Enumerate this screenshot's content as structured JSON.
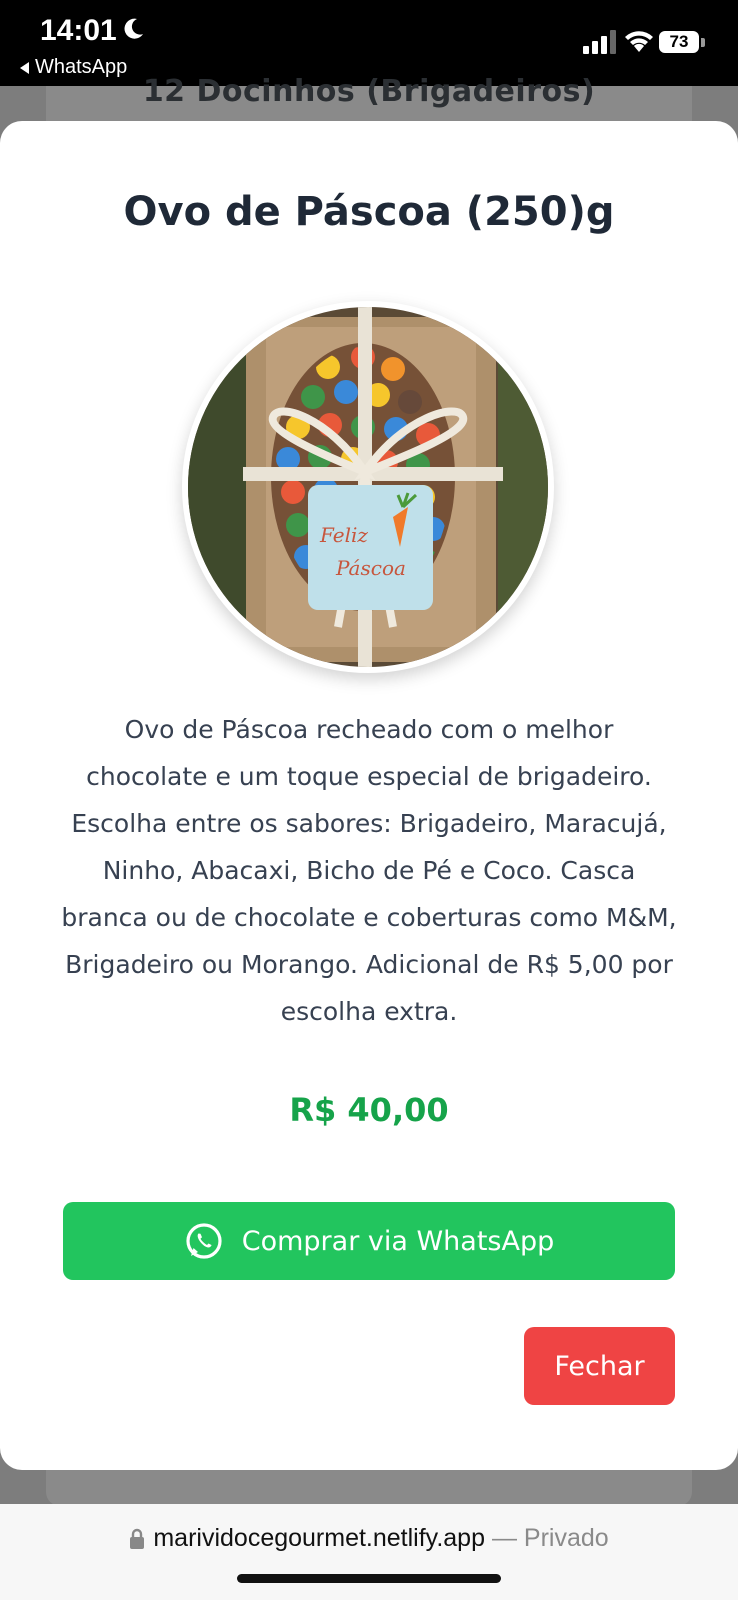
{
  "status_bar": {
    "time": "14:01",
    "back_app": "WhatsApp",
    "battery": "73"
  },
  "background_page": {
    "title": "12 Docinhos (Brigadeiros)"
  },
  "modal": {
    "title": "Ovo de Páscoa (250)g",
    "image_tag_text": "Feliz Páscoa",
    "description": "Ovo de Páscoa recheado com o melhor chocolate e um toque especial de brigadeiro. Escolha entre os sabores: Brigadeiro, Maracujá, Ninho, Abacaxi, Bicho de Pé e Coco. Casca branca ou de chocolate e coberturas como M&M, Brigadeiro ou Morango. Adicional de R$ 5,00 por escolha extra.",
    "price": "R$ 40,00",
    "buy_button_label": "Comprar via WhatsApp",
    "close_button_label": "Fechar"
  },
  "browser": {
    "url": "marividocegourmet.netlify.app",
    "separator": "—",
    "mode": "Privado"
  },
  "colors": {
    "price_green": "#16a34a",
    "whatsapp_green": "#22c55e",
    "close_red": "#ef4444",
    "title_dark": "#1f2937"
  }
}
